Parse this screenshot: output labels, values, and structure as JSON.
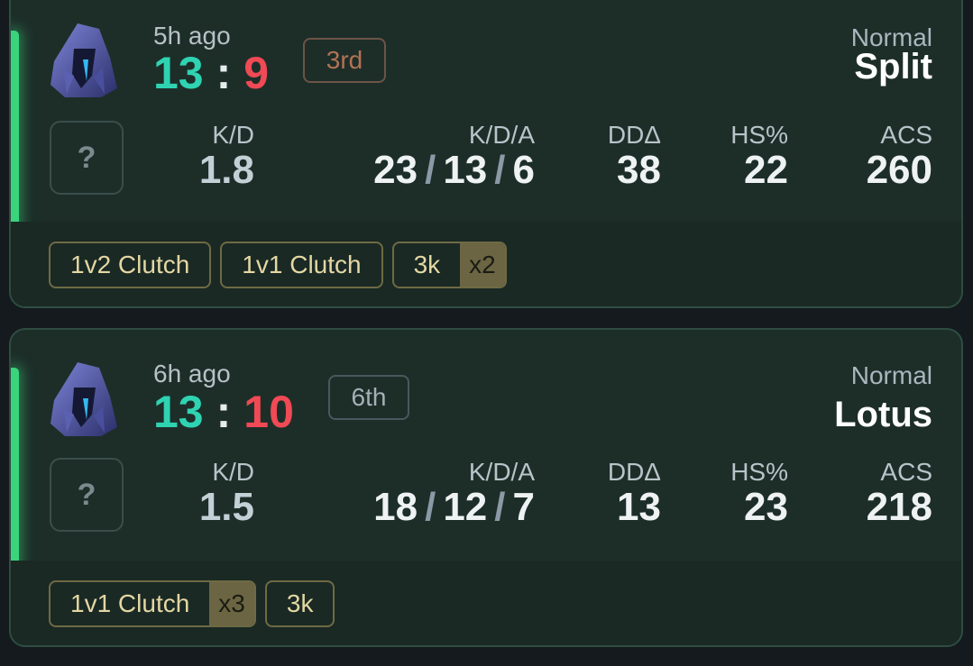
{
  "matches": [
    {
      "time_ago": "5h ago",
      "score": {
        "team": "13",
        "enemy": "9",
        "separator": ":"
      },
      "placement": "3rd",
      "mode": "Normal",
      "map": "Split",
      "unknown_badge": "?",
      "stats": {
        "kd_label": "K/D",
        "kd": "1.8",
        "kda_label": "K/D/A",
        "kills": "23",
        "deaths": "13",
        "assists": "6",
        "dd_label": "DDΔ",
        "dd": "38",
        "hs_label": "HS%",
        "hs": "22",
        "acs_label": "ACS",
        "acs": "260"
      },
      "badges": [
        {
          "label": "1v2 Clutch",
          "count": ""
        },
        {
          "label": "1v1 Clutch",
          "count": ""
        },
        {
          "label": "3k",
          "count": "x2"
        }
      ]
    },
    {
      "time_ago": "6h ago",
      "score": {
        "team": "13",
        "enemy": "10",
        "separator": ":"
      },
      "placement": "6th",
      "mode": "Normal",
      "map": "Lotus",
      "unknown_badge": "?",
      "stats": {
        "kd_label": "K/D",
        "kd": "1.5",
        "kda_label": "K/D/A",
        "kills": "18",
        "deaths": "12",
        "assists": "7",
        "dd_label": "DDΔ",
        "dd": "13",
        "hs_label": "HS%",
        "hs": "23",
        "acs_label": "ACS",
        "acs": "218"
      },
      "badges": [
        {
          "label": "1v1 Clutch",
          "count": "x3"
        },
        {
          "label": "3k",
          "count": ""
        }
      ]
    }
  ],
  "icons": {
    "agent": "agent-hooded-icon",
    "unknown": "question-mark-icon"
  },
  "colors": {
    "win": "#2fd3b2",
    "loss": "#ef4a55",
    "accent": "#3ad47c",
    "badge": "#e4d7a3"
  }
}
